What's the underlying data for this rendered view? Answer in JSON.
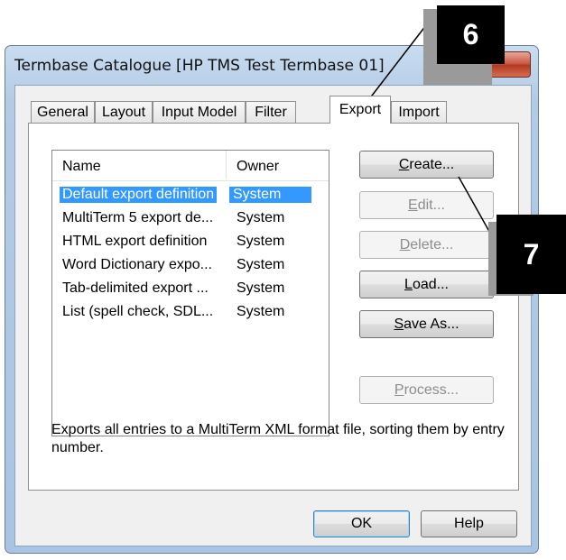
{
  "window": {
    "title": "Termbase Catalogue [HP TMS Test Termbase 01]"
  },
  "tabs": [
    {
      "label": "General",
      "active": false
    },
    {
      "label": "Layout",
      "active": false
    },
    {
      "label": "Input Model",
      "active": false
    },
    {
      "label": "Filter",
      "active": false
    },
    {
      "label": "Export",
      "active": true
    },
    {
      "label": "Import",
      "active": false
    }
  ],
  "list": {
    "columns": [
      "Name",
      "Owner"
    ],
    "rows": [
      {
        "name": "Default export definition",
        "owner": "System",
        "selected": true
      },
      {
        "name": "MultiTerm 5 export de...",
        "owner": "System",
        "selected": false
      },
      {
        "name": "HTML export definition",
        "owner": "System",
        "selected": false
      },
      {
        "name": "Word Dictionary expo...",
        "owner": "System",
        "selected": false
      },
      {
        "name": "Tab-delimited export ...",
        "owner": "System",
        "selected": false
      },
      {
        "name": "List (spell check, SDL...",
        "owner": "System",
        "selected": false
      }
    ]
  },
  "buttons": {
    "create": {
      "mnemonic": "C",
      "rest": "reate...",
      "enabled": true
    },
    "edit": {
      "mnemonic": "E",
      "rest": "dit...",
      "enabled": false
    },
    "delete": {
      "mnemonic": "D",
      "rest": "elete...",
      "enabled": false
    },
    "load": {
      "mnemonic": "L",
      "rest": "oad...",
      "enabled": true
    },
    "save_as": {
      "mnemonic": "S",
      "rest": "ave As...",
      "enabled": true
    },
    "process": {
      "mnemonic": "P",
      "rest": "rocess...",
      "enabled": false
    },
    "ok": "OK",
    "help": "Help"
  },
  "description": "Exports all entries to a MultiTerm XML format file, sorting them by entry number.",
  "callouts": {
    "c6": "6",
    "c7": "7"
  }
}
